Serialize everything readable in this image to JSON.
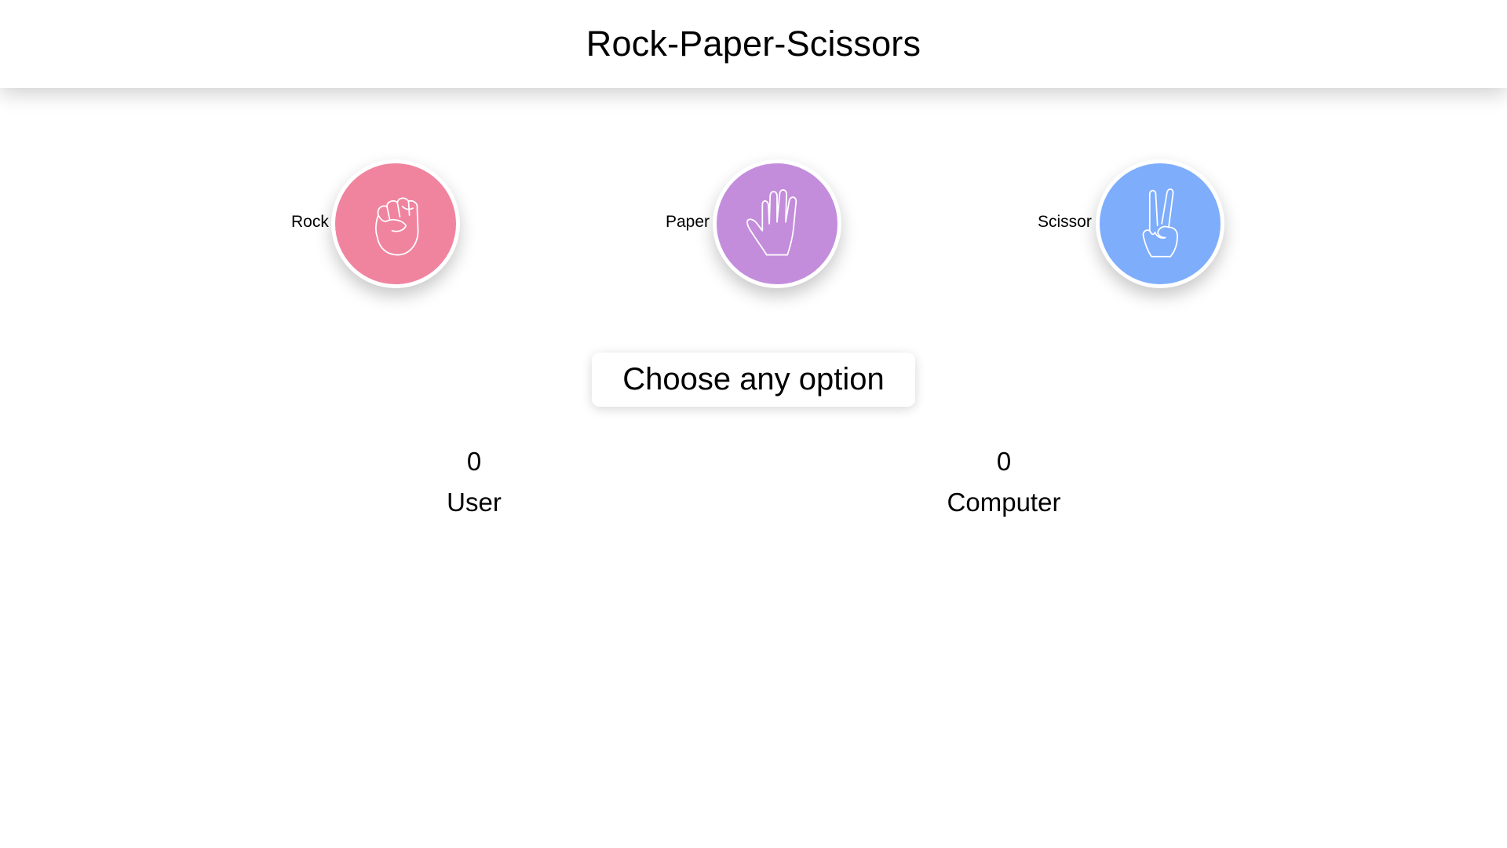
{
  "header": {
    "title": "Rock-Paper-Scissors"
  },
  "choices": [
    {
      "label": "Rock",
      "icon": "fist-icon",
      "color": "#f0849f"
    },
    {
      "label": "Paper",
      "icon": "open-hand-icon",
      "color": "#c38ddc"
    },
    {
      "label": "Scissor",
      "icon": "victory-hand-icon",
      "color": "#7eadfc"
    }
  ],
  "message": "Choose any option",
  "scoreboard": {
    "user": {
      "score": "0",
      "label": "User"
    },
    "computer": {
      "score": "0",
      "label": "Computer"
    }
  }
}
